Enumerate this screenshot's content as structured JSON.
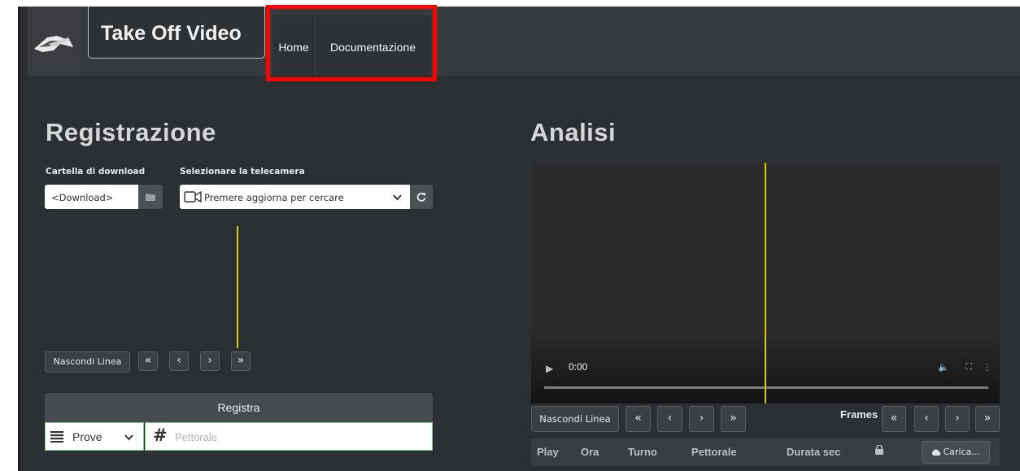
{
  "navbar": {
    "brand": "Take Off Video",
    "home": "Home",
    "documentation": "Documentazione"
  },
  "left": {
    "title": "Registrazione",
    "download_label": "Cartella di download",
    "download_value": "<Download>",
    "camera_label": "Selezionare la telecamera",
    "camera_value": "Premere aggiorna per cercare",
    "hide_line": "Nascondi Linea",
    "nav_first": "«",
    "nav_prev": "‹",
    "nav_next": "›",
    "nav_last": "»",
    "record": "Registra",
    "mode": "Prove",
    "bib_placeholder": "Pettorale",
    "hash": "#"
  },
  "right": {
    "title": "Analisi",
    "video_time": "0:00",
    "hide_line": "Nascondi Linea",
    "frames": "Frames",
    "nav_first": "«",
    "nav_prev": "‹",
    "nav_next": "›",
    "nav_last": "»",
    "table_headers": [
      "Play",
      "Ora",
      "Turno",
      "Pettorale",
      "Durata sec"
    ],
    "upload": "Carica..."
  },
  "colors": {
    "background": "#2c2f33",
    "navbar": "#383b3e",
    "highlight": "#ff0000",
    "guide_line": "#d4d000",
    "input_border": "#84c98c"
  },
  "icons": [
    "folder-icon",
    "camera-icon",
    "chevron-down-icon",
    "refresh-icon",
    "list-icon",
    "lock-icon",
    "cloud-upload-icon",
    "volume-icon",
    "fullscreen-icon",
    "more-icon",
    "play-icon"
  ]
}
